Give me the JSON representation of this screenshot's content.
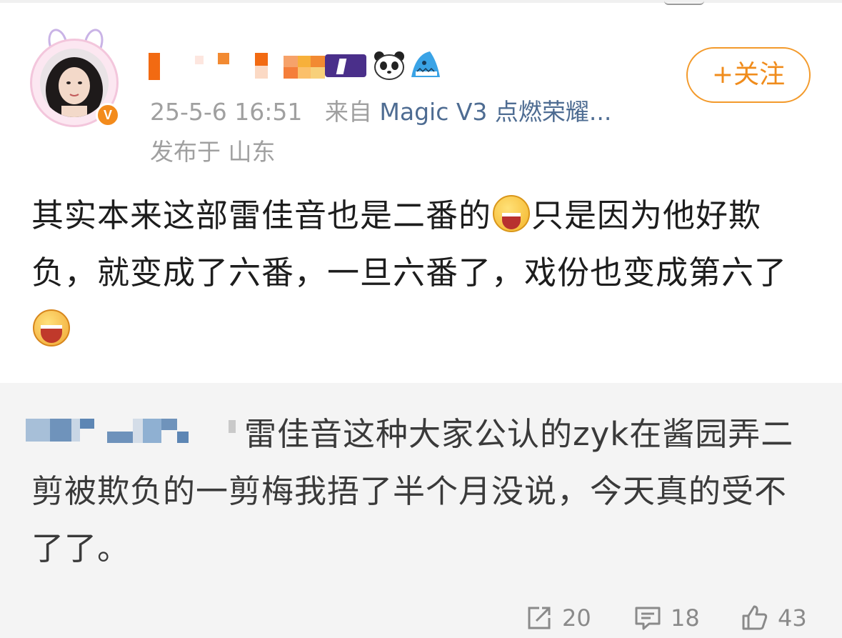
{
  "post": {
    "timestamp": "25-5-6 16:51",
    "source_prefix": "来自",
    "source_device": "Magic V3 点燃荣耀...",
    "location": "发布于 山东",
    "follow_label": "+关注",
    "text_line1": "其实本来这部雷佳音也是二番的",
    "text_line1b": "只是因为他好欺负，就变成了六番，一旦六番了，戏份也变成第六了"
  },
  "repost": {
    "text": "雷佳音这种大家公认的zyk在酱园弄二剪被欺负的一剪梅我捂了半个月没说，今天真的受不了了。"
  },
  "actions": {
    "repost_count": "20",
    "comment_count": "18",
    "like_count": "43"
  },
  "colors": {
    "accent_orange": "#f08c1c",
    "source_link": "#4e6c92",
    "meta_gray": "#a0a0a0",
    "repost_bg": "#f4f4f4"
  },
  "icons": {
    "verified": "verified-v-badge-icon",
    "panda": "panda-emoji-icon",
    "shark": "shark-emoji-icon",
    "grin": "grinning-face-emoji",
    "laugh": "laughing-face-emoji",
    "repost": "repost-arrow-icon",
    "comment": "comment-bubble-icon",
    "like": "thumbs-up-icon"
  }
}
